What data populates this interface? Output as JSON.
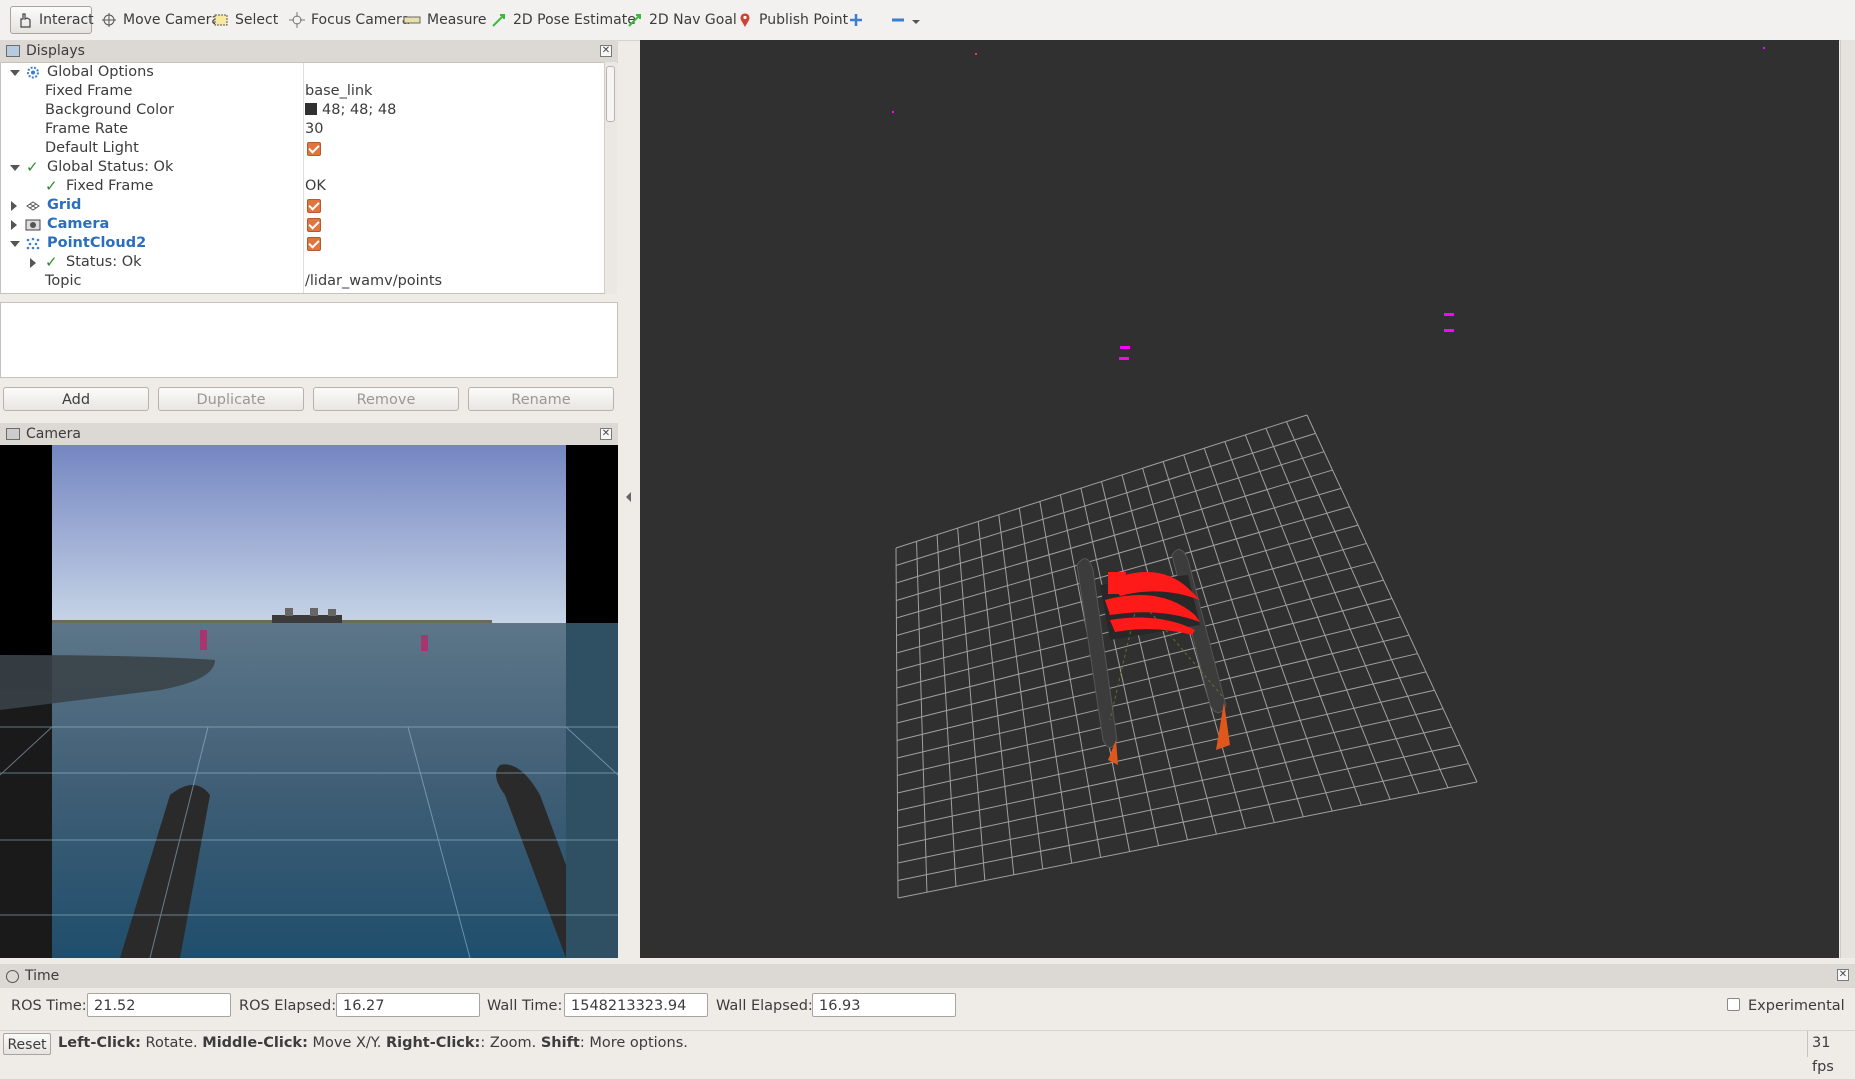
{
  "toolbar": {
    "tools": [
      {
        "label": "Interact",
        "icon": "hand-icon"
      },
      {
        "label": "Move Camera",
        "icon": "move-camera-icon"
      },
      {
        "label": "Select",
        "icon": "select-icon"
      },
      {
        "label": "Focus Camera",
        "icon": "focus-camera-icon"
      },
      {
        "label": "Measure",
        "icon": "measure-icon"
      },
      {
        "label": "2D Pose Estimate",
        "icon": "pose-arrow-icon"
      },
      {
        "label": "2D Nav Goal",
        "icon": "nav-goal-arrow-icon"
      },
      {
        "label": "Publish Point",
        "icon": "map-pin-icon"
      }
    ]
  },
  "displays": {
    "title": "Displays",
    "rows": [
      {
        "label": "Global Options",
        "value": ""
      },
      {
        "label": "Fixed Frame",
        "value": "base_link"
      },
      {
        "label": "Background Color",
        "value": "48; 48; 48"
      },
      {
        "label": "Frame Rate",
        "value": "30"
      },
      {
        "label": "Default Light",
        "value": ""
      },
      {
        "label": "Global Status: Ok",
        "value": ""
      },
      {
        "label": "Fixed Frame",
        "value": "OK"
      },
      {
        "label": "Grid",
        "value": ""
      },
      {
        "label": "Camera",
        "value": ""
      },
      {
        "label": "PointCloud2",
        "value": ""
      },
      {
        "label": "Status: Ok",
        "value": ""
      },
      {
        "label": "Topic",
        "value": "/lidar_wamv/points"
      }
    ],
    "buttons": {
      "add": "Add",
      "duplicate": "Duplicate",
      "remove": "Remove",
      "rename": "Rename"
    }
  },
  "camera": {
    "title": "Camera"
  },
  "time": {
    "title": "Time",
    "ros_time_label": "ROS Time:",
    "ros_time": "21.52",
    "ros_elapsed_label": "ROS Elapsed:",
    "ros_elapsed": "16.27",
    "wall_time_label": "Wall Time:",
    "wall_time": "1548213323.94",
    "wall_elapsed_label": "Wall Elapsed:",
    "wall_elapsed": "16.93",
    "experimental_label": "Experimental"
  },
  "status": {
    "reset": "Reset",
    "left_click": "Left-Click:",
    "left_desc": " Rotate. ",
    "middle_click": "Middle-Click:",
    "middle_desc": " Move X/Y. ",
    "right_click": "Right-Click:",
    "right_desc": ": Zoom. ",
    "shift": "Shift",
    "shift_desc": ": More options.",
    "fps": "31 fps"
  },
  "colors": {
    "view_background": "#303030",
    "checkbox": "#e2743d",
    "pointcloud": "#ff0000",
    "markers": "#ff00ff"
  }
}
